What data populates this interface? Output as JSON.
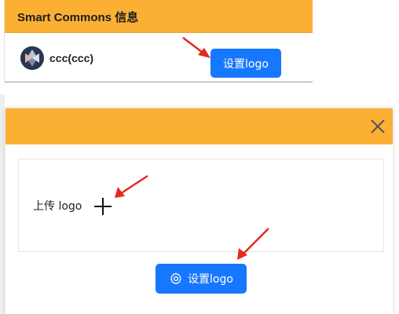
{
  "info_panel": {
    "title": "Smart Commons 信息",
    "user_name": "ccc(ccc)",
    "set_logo_label": "设置logo"
  },
  "modal": {
    "upload_label": "上传 logo",
    "set_logo_label": "设置logo",
    "close_icon": "close-icon",
    "upload_icon": "plus-icon",
    "button_icon": "gear-icon"
  },
  "colors": {
    "header": "#fbb034",
    "primary": "#1677ff",
    "annotation": "#e8281e"
  }
}
